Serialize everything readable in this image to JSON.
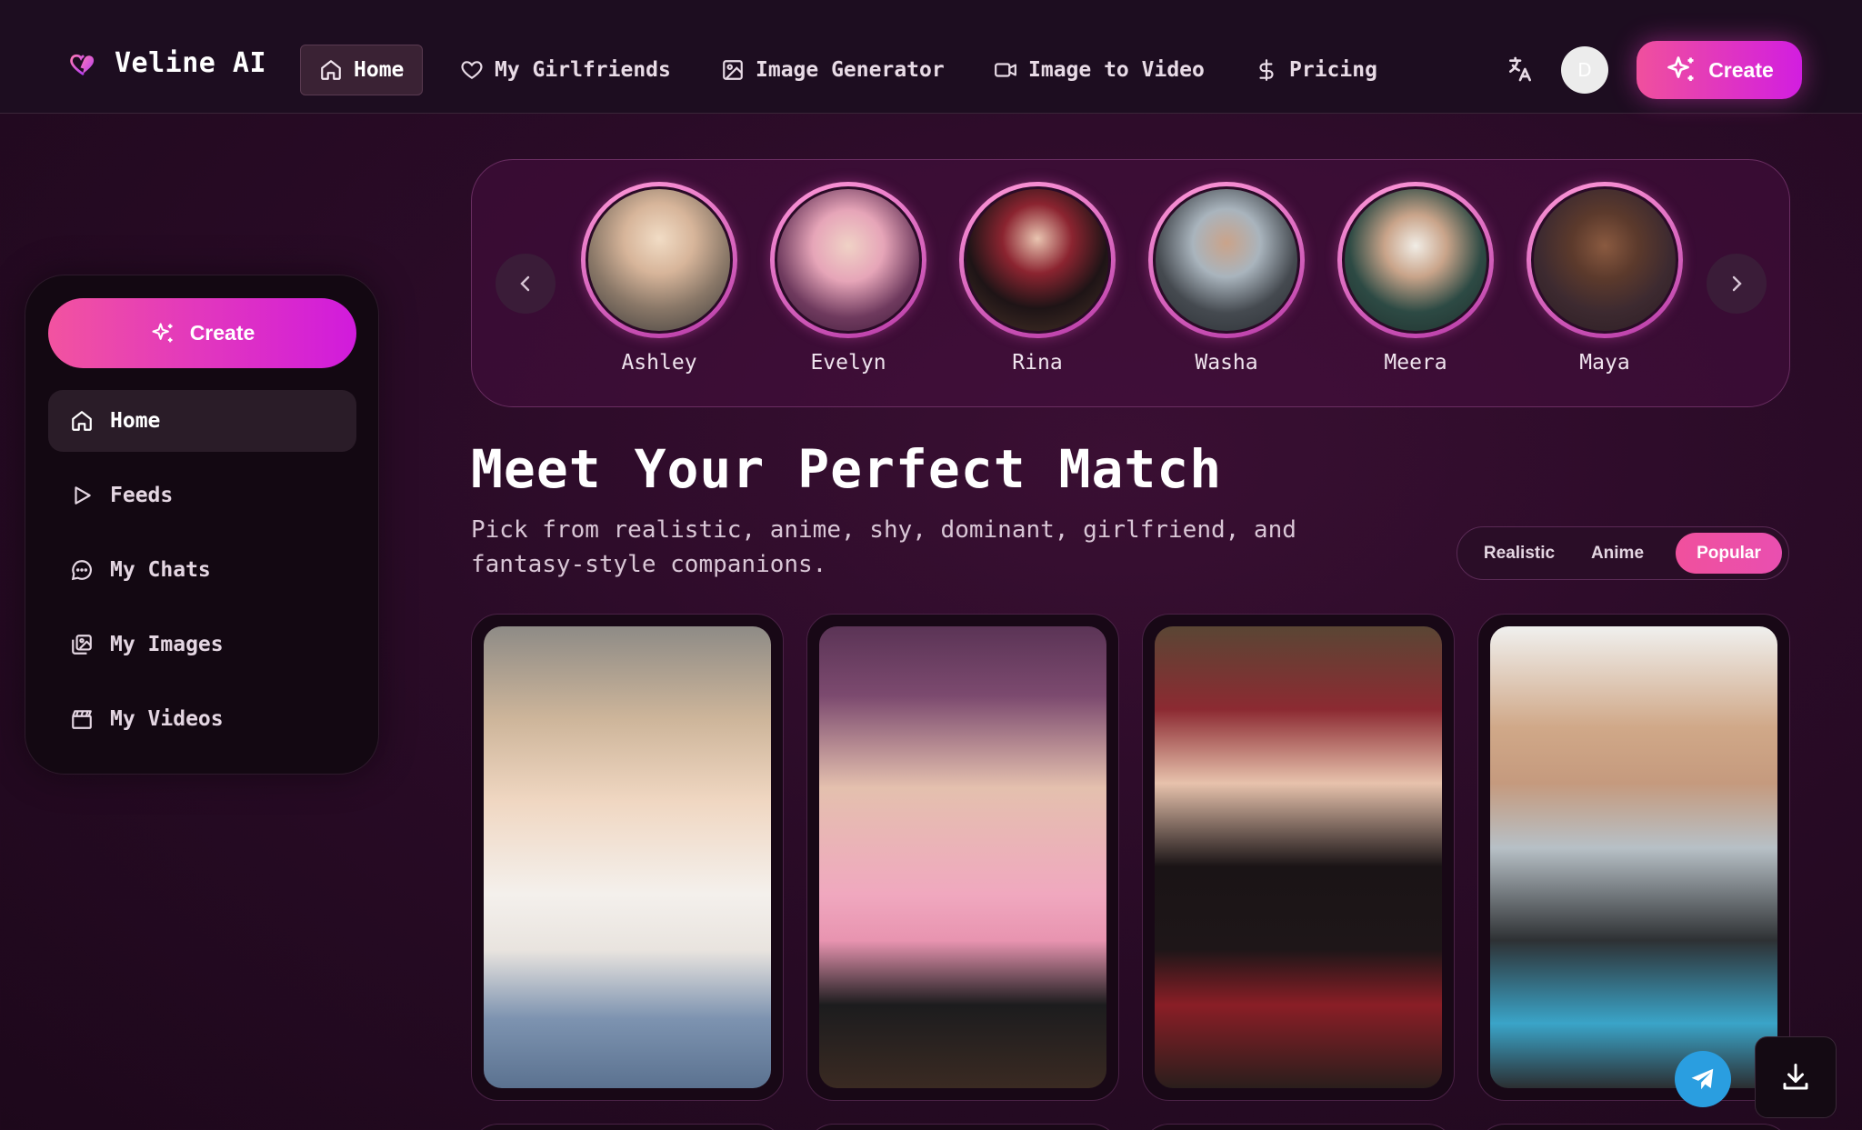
{
  "brand": {
    "name": "Veline AI",
    "accent": "#f0509d"
  },
  "nav": {
    "items": [
      {
        "label": "Home",
        "icon": "home-icon",
        "active": true
      },
      {
        "label": "My Girlfriends",
        "icon": "heart-icon"
      },
      {
        "label": "Image Generator",
        "icon": "image-icon"
      },
      {
        "label": "Image to Video",
        "icon": "video-icon"
      },
      {
        "label": "Pricing",
        "icon": "dollar-icon"
      }
    ],
    "translate_icon": "translate-icon",
    "avatar_initial": "D",
    "create_label": "Create"
  },
  "sidebar": {
    "create_label": "Create",
    "items": [
      {
        "label": "Home",
        "icon": "home-icon",
        "active": true
      },
      {
        "label": "Feeds",
        "icon": "play-icon"
      },
      {
        "label": "My Chats",
        "icon": "chat-icon"
      },
      {
        "label": "My Images",
        "icon": "images-icon"
      },
      {
        "label": "My Videos",
        "icon": "clapperboard-icon"
      }
    ]
  },
  "stories": {
    "prev_icon": "chevron-left-icon",
    "next_icon": "chevron-right-icon",
    "items": [
      {
        "name": "Ashley"
      },
      {
        "name": "Evelyn"
      },
      {
        "name": "Rina"
      },
      {
        "name": "Washa"
      },
      {
        "name": "Meera"
      },
      {
        "name": "Maya"
      }
    ]
  },
  "main": {
    "title": "Meet Your Perfect Match",
    "subtitle": "Pick from realistic, anime, shy, dominant, girlfriend, and fantasy-style companions.",
    "filters": [
      {
        "label": "Realistic"
      },
      {
        "label": "Anime"
      },
      {
        "label": "Popular",
        "active": true
      }
    ]
  },
  "floating": {
    "telegram_icon": "telegram-icon",
    "download_icon": "download-icon"
  }
}
